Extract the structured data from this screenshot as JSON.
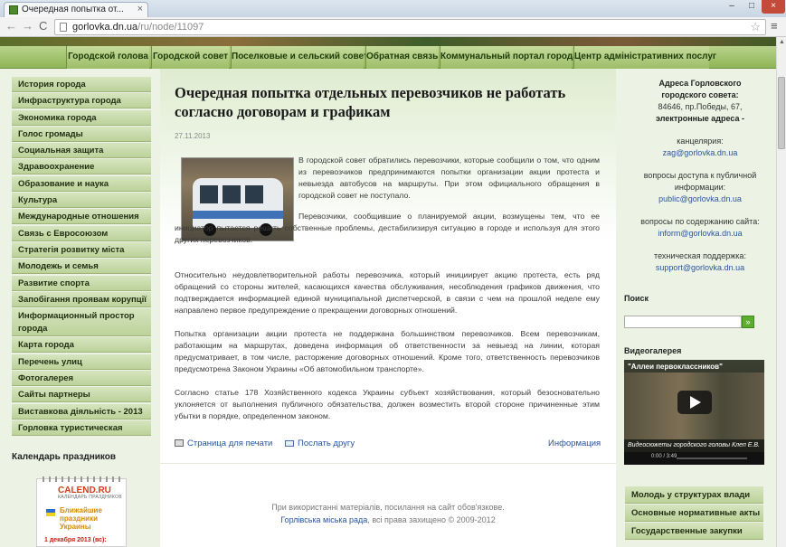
{
  "browser": {
    "tab_title": "Очередная попытка от...",
    "tab_close": "×",
    "win_min": "–",
    "win_max": "□",
    "win_close": "×",
    "url_host": "gorlovka.dn.ua",
    "url_path": "/ru/node/11097",
    "nav_back": "←",
    "nav_fwd": "→",
    "nav_reload": "C",
    "star": "☆",
    "menu": "≡"
  },
  "topnav": [
    "Городской голова",
    "Городской совет",
    "Поселковые и сельский советы",
    "Обратная связь",
    "Коммунальный портал города",
    "Центр адміністративних послуг"
  ],
  "leftnav": [
    "История города",
    "Инфраструктура города",
    "Экономика города",
    "Голос громады",
    "Социальная защита",
    "Здравоохранение",
    "Образование и наука",
    "Культура",
    "Международные отношения",
    "Связь с Евросоюзом",
    "Стратегія розвитку міста",
    "Молодежь и семья",
    "Развитие спорта",
    "Запобігання проявам корупції",
    "Информационный простор города",
    "Карта города",
    "Перечень улиц",
    "Фотогалерея",
    "Сайты партнеры",
    "Виставкова діяльність - 2013",
    "Горловка туристическая"
  ],
  "calendar": {
    "heading": "Календарь праздников",
    "logo": "CALEND.RU",
    "logo_sub": "КАЛЕНДАРЬ ПРАЗДНИКОВ",
    "holidays": "Ближайшие праздники Украины",
    "date": "1 декабря 2013 (вс):"
  },
  "article": {
    "title": "Очередная попытка отдельных перевозчиков не работать согласно договорам и графикам",
    "date": "27.11.2013",
    "p1": "В городской совет обратились перевозчики, которые сообщили о том, что одним из перевозчиков предпринимаются попытки организации акции протеста и невыезда автобусов на маршруты. При этом официального обращения в городской совет не поступало.",
    "p2": "Перевозчики, сообщившие о планируемой акции, возмущены тем, что ее инициатор пытается решить собственные проблемы, дестабилизируя ситуацию в городе и используя для этого других перевозчиков.",
    "p3": "Относительно неудовлетворительной работы перевозчика, который инициирует акцию протеста, есть ряд обращений со стороны жителей, касающихся качества обслуживания, несоблюдения графиков движения, что подтверждается информацией единой муниципальной диспетчерской, в связи с чем на прошлой неделе ему направлено первое предупреждение о прекращении договорных отношений.",
    "p4": "Попытка организации акции протеста не поддержана большинством перевозчиков. Всем перевозчикам, работающим на маршрутах, доведена информация об ответственности за невыезд на линии, которая предусматривает, в том числе, расторжение договорных отношений. Кроме того, ответственность перевозчиков предусмотрена Законом Украины «Об автомобильном транспорте».",
    "p5": "Согласно статье 178 Хозяйственного кодекса Украины субъект хозяйствования, который безосновательно уклоняется от выполнения публичного обязательства, должен возместить второй стороне причиненные этим убытки в порядке, определенном законом.",
    "print_link": "Страница для печати",
    "send_link": "Послать другу",
    "info_link": "Информация"
  },
  "footer": {
    "line1": "При використанні матеріалів, посилання на сайт обов'язкове.",
    "owner_link": "Горлівська міська рада",
    "line2_rest": ", всі права захищено © 2009-2012"
  },
  "right": {
    "addr_title": "Адреса Горловского городского совета:",
    "addr_street": "84646, пр.Победы, 67,",
    "addr_emails": "электронные адреса -",
    "office_label": "канцелярия:",
    "office_email": "zag@gorlovka.dn.ua",
    "public_label": "вопросы доступа к публичной информации:",
    "public_email": "public@gorlovka.dn.ua",
    "content_label": "вопросы по содержанию сайта:",
    "content_email": "inform@gorlovka.dn.ua",
    "support_label": "техническая поддержка:",
    "support_email": "support@gorlovka.dn.ua",
    "search_heading": "Поиск",
    "search_btn": "»",
    "video_heading": "Видеогалерея",
    "video_title": "\"Аллеи первоклассников\"",
    "video_caption": "Видеосюжеты городского головы Клеп Е.В.",
    "video_time": "0:00 / 3:49"
  },
  "rightnav": [
    "Молодь у структурах влади",
    "Основные нормативные акты",
    "Государственные закупки"
  ],
  "colors": {
    "nav_green": "#9dbd68",
    "link_blue": "#2a55a0",
    "page_bg": "#edf3e4"
  }
}
